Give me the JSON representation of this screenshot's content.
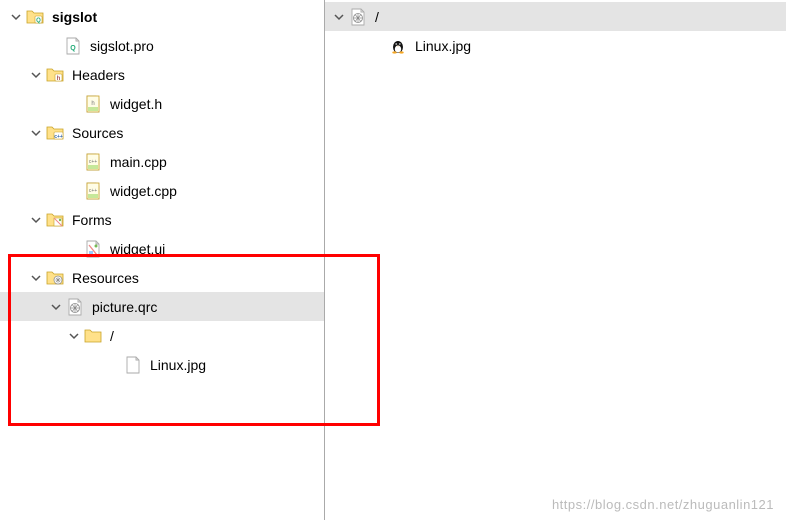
{
  "left_tree": {
    "items": [
      {
        "indent": 8,
        "expander": "down",
        "icon": "folder-q",
        "label": "sigslot",
        "bold": true,
        "selected": false,
        "interactable": true
      },
      {
        "indent": 46,
        "expander": "none",
        "icon": "file-q",
        "label": "sigslot.pro",
        "bold": false,
        "selected": false,
        "interactable": true
      },
      {
        "indent": 28,
        "expander": "down",
        "icon": "folder-h",
        "label": "Headers",
        "bold": false,
        "selected": false,
        "interactable": true
      },
      {
        "indent": 66,
        "expander": "none",
        "icon": "file-h",
        "label": "widget.h",
        "bold": false,
        "selected": false,
        "interactable": true
      },
      {
        "indent": 28,
        "expander": "down",
        "icon": "folder-cpp",
        "label": "Sources",
        "bold": false,
        "selected": false,
        "interactable": true
      },
      {
        "indent": 66,
        "expander": "none",
        "icon": "file-cpp",
        "label": "main.cpp",
        "bold": false,
        "selected": false,
        "interactable": true
      },
      {
        "indent": 66,
        "expander": "none",
        "icon": "file-cpp",
        "label": "widget.cpp",
        "bold": false,
        "selected": false,
        "interactable": true
      },
      {
        "indent": 28,
        "expander": "down",
        "icon": "folder-ui",
        "label": "Forms",
        "bold": false,
        "selected": false,
        "interactable": true
      },
      {
        "indent": 66,
        "expander": "none",
        "icon": "file-ui",
        "label": "widget.ui",
        "bold": false,
        "selected": false,
        "interactable": true
      },
      {
        "indent": 28,
        "expander": "down",
        "icon": "folder-qrc",
        "label": "Resources",
        "bold": false,
        "selected": false,
        "interactable": true
      },
      {
        "indent": 48,
        "expander": "down",
        "icon": "file-qrc",
        "label": "picture.qrc",
        "bold": false,
        "selected": true,
        "interactable": true
      },
      {
        "indent": 66,
        "expander": "down",
        "icon": "folder-yel",
        "label": "/",
        "bold": false,
        "selected": false,
        "interactable": true
      },
      {
        "indent": 106,
        "expander": "none",
        "icon": "file-plain",
        "label": "Linux.jpg",
        "bold": false,
        "selected": false,
        "interactable": true
      }
    ]
  },
  "right_tree": {
    "items": [
      {
        "indent": 6,
        "expander": "down",
        "icon": "file-qrc",
        "label": "/",
        "bold": false,
        "selected": true,
        "interactable": true
      },
      {
        "indent": 46,
        "expander": "none",
        "icon": "tux",
        "label": "Linux.jpg",
        "bold": false,
        "selected": false,
        "interactable": true
      }
    ]
  },
  "watermark": "https://blog.csdn.net/zhuguanlin121"
}
